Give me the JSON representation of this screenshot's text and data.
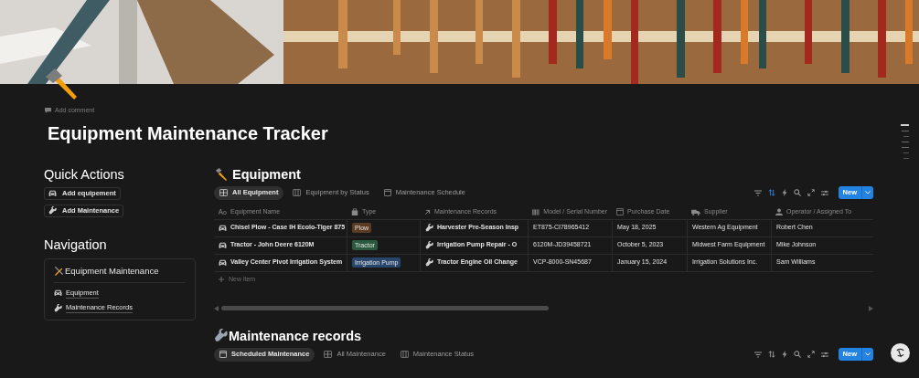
{
  "add_comment": "Add comment",
  "title": "Equipment Maintenance Tracker",
  "quick_actions": {
    "heading": "Quick Actions",
    "buttons": [
      {
        "label": "Add equipement",
        "kind": "car"
      },
      {
        "label": "Add Maintenance",
        "kind": "wrench"
      }
    ]
  },
  "navigation": {
    "heading": "Navigation",
    "card_title": "Equipment Maintenance",
    "links": [
      {
        "label": "Equipment",
        "kind": "car"
      },
      {
        "label": "Maintenance Records",
        "kind": "wrench"
      }
    ]
  },
  "databases": [
    {
      "title": "Equipment",
      "kind": "hammer",
      "sort_active": true,
      "new_button": "New",
      "tabs": [
        {
          "label": "All Equipment",
          "kind": "table",
          "selected": true
        },
        {
          "label": "Equipment by Status",
          "kind": "board",
          "selected": false
        },
        {
          "label": "Maintenance Schedule",
          "kind": "calendar",
          "selected": false
        }
      ],
      "columns": [
        {
          "label": "Equipment Name",
          "kind": "title"
        },
        {
          "label": "Type",
          "kind": "select"
        },
        {
          "label": "Maintenance Records",
          "kind": "relation"
        },
        {
          "label": "Model / Serial Number",
          "kind": "text"
        },
        {
          "label": "Purchase Date",
          "kind": "date"
        },
        {
          "label": "Supplier",
          "kind": "supplier"
        },
        {
          "label": "Operator / Assigned To",
          "kind": "person"
        }
      ],
      "rows": [
        {
          "name": "Chisel Plow - Case IH Ecolo-Tiger 875",
          "type": {
            "label": "Plow",
            "color": "#5c3b23"
          },
          "record": "Harvester Pre-Season Insp",
          "model": "ET875-CI78965412",
          "date": "May 18, 2025",
          "supplier": "Western Ag Equipment",
          "operator": "Robert Chen"
        },
        {
          "name": "Tractor - John Deere 6120M",
          "type": {
            "label": "Tractor",
            "color": "#2b593f"
          },
          "record": "Irrigation Pump Repair - O",
          "model": "6120M-JD39458721",
          "date": "October 5, 2023",
          "supplier": "Midwest Farm Equipment",
          "operator": "Mike Johnson"
        },
        {
          "name": "Valley Center Pivot Irrigation System",
          "type": {
            "label": "Irrigation Pump",
            "color": "#28456c"
          },
          "record": "Tractor Engine Oil Change",
          "model": "VCP-8000-SN45687",
          "date": "January 15, 2024",
          "supplier": "Irrigation Solutions Inc.",
          "operator": "Sam Williams"
        }
      ],
      "new_item": "New item"
    },
    {
      "title": "Maintenance records",
      "kind": "wrench",
      "sort_active": false,
      "new_button": "New",
      "tabs": [
        {
          "label": "Scheduled Maintenance",
          "kind": "calendar",
          "selected": true
        },
        {
          "label": "All Maintenance",
          "kind": "table",
          "selected": false
        },
        {
          "label": "Maintenance Status",
          "kind": "board",
          "selected": false
        }
      ]
    }
  ]
}
